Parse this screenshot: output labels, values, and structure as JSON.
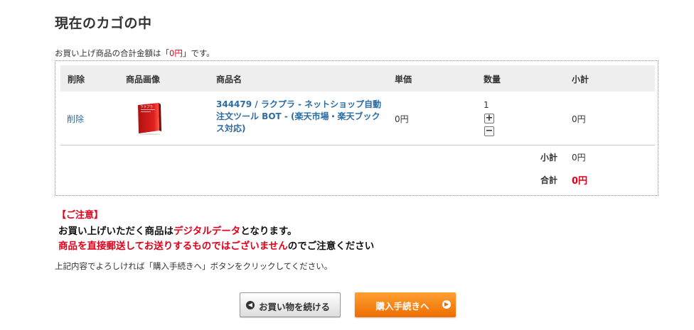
{
  "page": {
    "title": "現在のカゴの中",
    "summary_prefix": "お買い上げ商品の合計金額は「",
    "summary_amount": "0円",
    "summary_suffix": "」です。"
  },
  "cart": {
    "headers": {
      "delete": "削除",
      "image": "商品画像",
      "name": "商品名",
      "unit_price": "単価",
      "quantity": "数量",
      "subtotal": "小計"
    },
    "item": {
      "delete_label": "削除",
      "name": "344479 / ラクプラ - ネットショップ自動注文ツール BOT - (楽天市場・楽天ブックス対応)",
      "product_image_text": "ラクプラ",
      "unit_price": "0円",
      "quantity": "1",
      "plus": "+",
      "minus": "−",
      "subtotal": "0円"
    },
    "totals": {
      "subtotal_label": "小計",
      "subtotal_value": "0円",
      "total_label": "合計",
      "total_value": "0円"
    }
  },
  "notice": {
    "heading": "【ご注意】",
    "line1_a": "お買い上げいただく商品は",
    "line1_b": "デジタルデータ",
    "line1_c": "となります。",
    "line2_a": "商品を直接郵送してお送りするものではございません",
    "line2_b": "のでご注意ください",
    "info": "上記内容でよろしければ「購入手続きへ」ボタンをクリックしてください。"
  },
  "buttons": {
    "continue_label": "お買い物を続ける",
    "checkout_label": "購入手続きへ"
  },
  "colors": {
    "accent_red": "#e0001a",
    "link_blue": "#2b6ca3",
    "orange": "#ee6d00",
    "box_border": "#e07a00"
  },
  "icons": {
    "continue": "chevron-left-circle-icon",
    "checkout": "chevron-right-circle-icon"
  }
}
